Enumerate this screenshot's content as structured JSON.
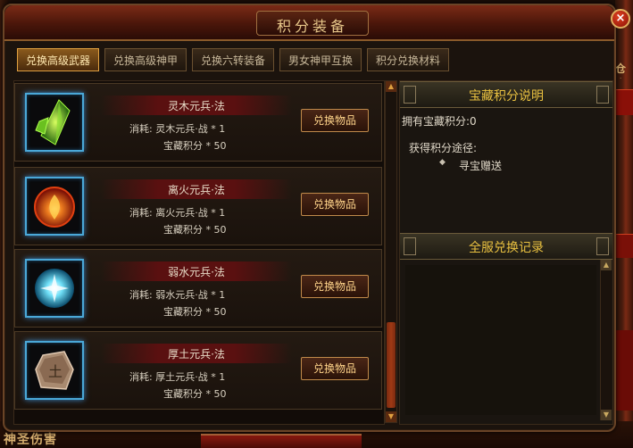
{
  "window": {
    "title": "积分装备",
    "close_label": "×"
  },
  "tabs": [
    {
      "label": "兑换高级武器",
      "active": true
    },
    {
      "label": "兑换高级神甲",
      "active": false
    },
    {
      "label": "兑换六转装备",
      "active": false
    },
    {
      "label": "男女神甲互换",
      "active": false
    },
    {
      "label": "积分兑换材料",
      "active": false
    }
  ],
  "items": [
    {
      "name": "灵木元兵·法",
      "cost": "消耗: 灵木元兵·战 * 1",
      "points": "宝藏积分 * 50",
      "button": "兑换物品",
      "icon": "wood-crystal-icon",
      "color": "#6ad030"
    },
    {
      "name": "离火元兵·法",
      "cost": "消耗: 离火元兵·战 * 1",
      "points": "宝藏积分 * 50",
      "button": "兑换物品",
      "icon": "fire-orb-icon",
      "color": "#e84018"
    },
    {
      "name": "弱水元兵·法",
      "cost": "消耗: 弱水元兵·战 * 1",
      "points": "宝藏积分 * 50",
      "button": "兑换物品",
      "icon": "water-orb-icon",
      "color": "#50d0e8"
    },
    {
      "name": "厚土元兵·法",
      "cost": "消耗: 厚土元兵·战 * 1",
      "points": "宝藏积分 * 50",
      "button": "兑换物品",
      "icon": "earth-stone-icon",
      "color": "#c0a080"
    }
  ],
  "info": {
    "title": "宝藏积分说明",
    "owned_points": "拥有宝藏积分:0",
    "obtain_label": "获得积分途径:",
    "route": "寻宝赠送"
  },
  "log": {
    "title": "全服兑换记录"
  },
  "background": {
    "bottom_text": "神圣伤害",
    "right_text": "仓库"
  },
  "colors": {
    "accent_gold": "#e8c040",
    "tab_active": "#8a5a1c",
    "frame_blue": "#4aa8d8"
  }
}
